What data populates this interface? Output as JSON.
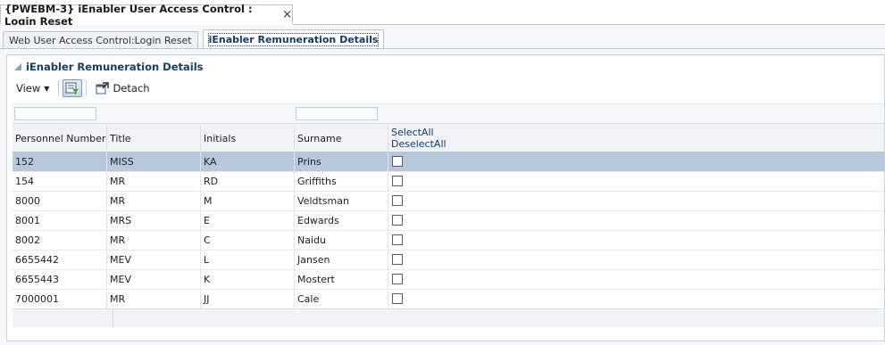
{
  "window": {
    "tab_title": "{PWEBM-3} iEnabler User Access Control : Login Reset",
    "close_glyph": "×"
  },
  "subtabs": [
    {
      "label": "Web User Access Control:Login Reset",
      "active": false
    },
    {
      "label": "iEnabler Remuneration Details",
      "active": true
    }
  ],
  "panel": {
    "title": "iEnabler Remuneration Details"
  },
  "toolbar": {
    "view_label": "View",
    "detach_label": "Detach"
  },
  "table": {
    "columns": [
      "Personnel Number",
      "Title",
      "Initials",
      "Surname"
    ],
    "select_all": "SelectAll",
    "deselect_all": "DeselectAll",
    "rows": [
      {
        "number": "152",
        "title": "MISS",
        "initials": "KA",
        "surname": "Prins",
        "selected": true
      },
      {
        "number": "154",
        "title": "MR",
        "initials": "RD",
        "surname": "Griffiths",
        "selected": false
      },
      {
        "number": "8000",
        "title": "MR",
        "initials": "M",
        "surname": "Veldtsman",
        "selected": false
      },
      {
        "number": "8001",
        "title": "MRS",
        "initials": "E",
        "surname": "Edwards",
        "selected": false
      },
      {
        "number": "8002",
        "title": "MR",
        "initials": "C",
        "surname": "Naidu",
        "selected": false
      },
      {
        "number": "6655442",
        "title": "MEV",
        "initials": "L",
        "surname": "Jansen",
        "selected": false
      },
      {
        "number": "6655443",
        "title": "MEV",
        "initials": "K",
        "surname": "Mostert",
        "selected": false
      },
      {
        "number": "7000001",
        "title": "MR",
        "initials": "JJ",
        "surname": "Cale",
        "selected": false
      }
    ]
  },
  "colors": {
    "selected_row": "#b7c7dc",
    "header_text": "#0f3f6d",
    "border": "#b9c6d4"
  }
}
